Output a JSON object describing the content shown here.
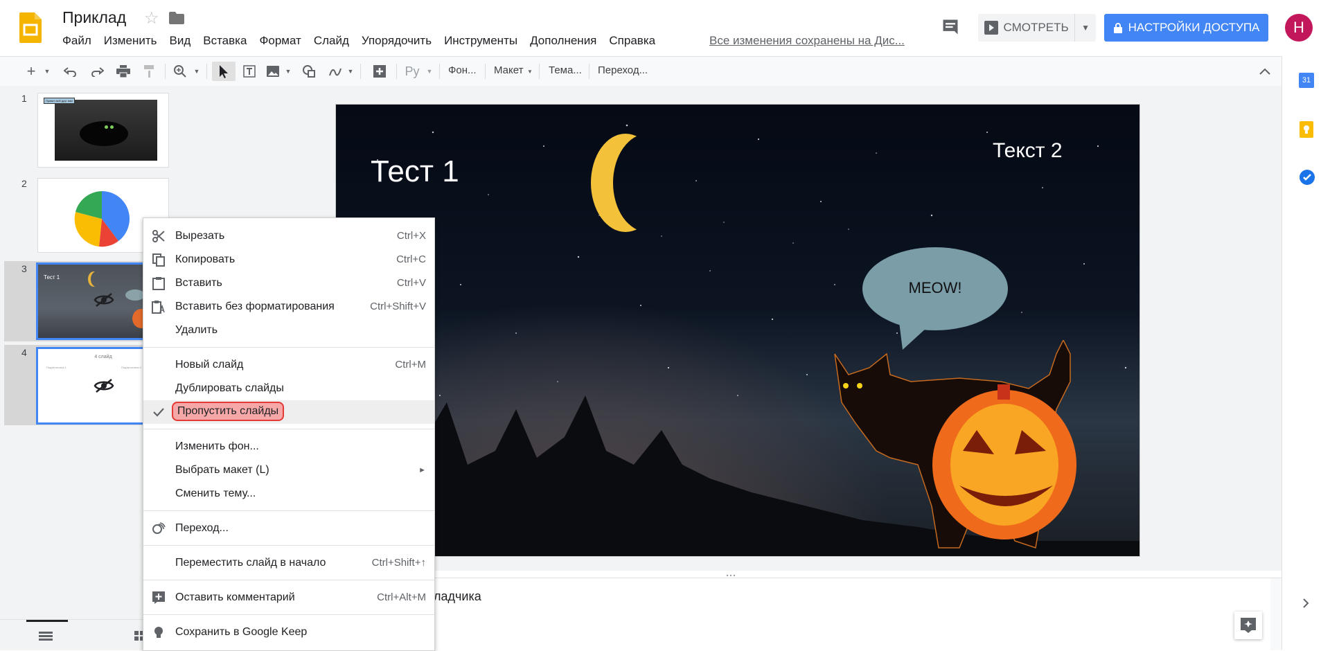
{
  "header": {
    "doc_title": "Приклад",
    "menu": [
      "Файл",
      "Изменить",
      "Вид",
      "Вставка",
      "Формат",
      "Слайд",
      "Упорядочить",
      "Инструменты",
      "Дополнения",
      "Справка"
    ],
    "saved_status": "Все изменения сохранены на Дис...",
    "present_label": "СМОТРЕТЬ",
    "share_label": "НАСТРОЙКИ ДОСТУПА",
    "avatar_letter": "Н"
  },
  "toolbar": {
    "input_tools": "Ру",
    "background": "Фон...",
    "layout": "Макет",
    "theme": "Тема...",
    "transition": "Переход..."
  },
  "sidepanel": {
    "calendar_day": "31"
  },
  "filmstrip": {
    "slides": [
      {
        "number": "1",
        "title": "Привет мой друг вам"
      },
      {
        "number": "2"
      },
      {
        "number": "3",
        "title": "Тест 1"
      },
      {
        "number": "4",
        "title": "4 слайд",
        "left_text": "Подзаголовок 1",
        "right_text": "Подзаголовок 2"
      }
    ]
  },
  "slide": {
    "title": "Тест 1",
    "text2": "Текст 2",
    "bubble": "MEOW!"
  },
  "notes": {
    "text": "Нажмите, чтобы добавить заметки докладчика",
    "visible_fragment": "ладчика"
  },
  "context_menu": {
    "items": [
      {
        "label": "Вырезать",
        "shortcut": "Ctrl+X",
        "icon": "scissors-icon"
      },
      {
        "label": "Копировать",
        "shortcut": "Ctrl+C",
        "icon": "copy-icon"
      },
      {
        "label": "Вставить",
        "shortcut": "Ctrl+V",
        "icon": "paste-icon"
      },
      {
        "label": "Вставить без форматирования",
        "shortcut": "Ctrl+Shift+V",
        "icon": "paste-plain-icon"
      },
      {
        "label": "Удалить",
        "shortcut": ""
      },
      {
        "label": "Новый слайд",
        "shortcut": "Ctrl+M"
      },
      {
        "label": "Дублировать слайды",
        "shortcut": ""
      },
      {
        "label": "Пропустить слайды",
        "shortcut": "",
        "checked": true,
        "highlighted": true
      },
      {
        "label": "Изменить фон...",
        "shortcut": ""
      },
      {
        "label": "Выбрать макет (L)",
        "shortcut": "",
        "submenu": true
      },
      {
        "label": "Сменить тему...",
        "shortcut": ""
      },
      {
        "label": "Переход...",
        "shortcut": "",
        "icon": "transition-icon"
      },
      {
        "label": "Переместить слайд в начало",
        "shortcut": "Ctrl+Shift+↑"
      },
      {
        "label": "Оставить комментарий",
        "shortcut": "Ctrl+Alt+M",
        "icon": "add-comment-icon"
      },
      {
        "label": "Сохранить в Google Keep",
        "shortcut": "",
        "icon": "keep-bulb-icon"
      }
    ]
  },
  "colors": {
    "accent": "#4285f4",
    "skip_highlight": "#f6a8a8",
    "skip_border": "#e53935",
    "avatar": "#c2185b"
  }
}
